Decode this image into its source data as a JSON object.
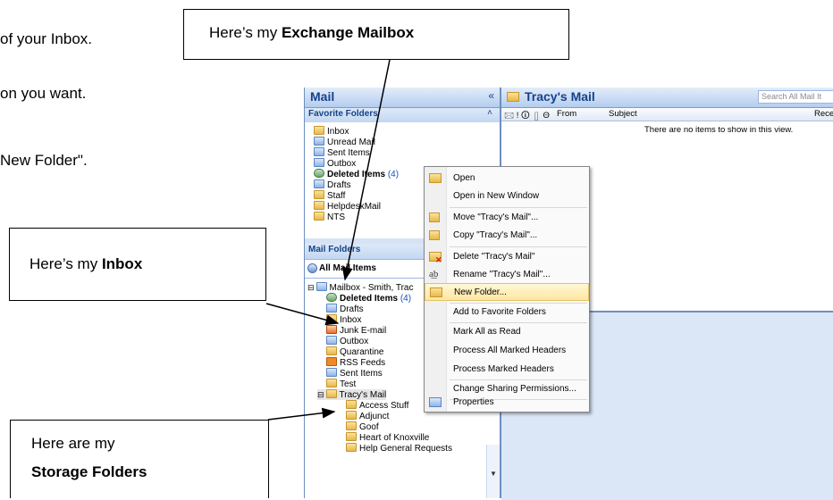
{
  "document": {
    "line1": "of your Inbox.",
    "line2": "on you want.",
    "line3": "New Folder\"."
  },
  "callouts": {
    "exchange": {
      "prefix": "Here’s my ",
      "bold": "Exchange Mailbox"
    },
    "inbox": {
      "prefix": "Here’s my ",
      "bold": "Inbox"
    },
    "storage": {
      "line1": "Here are my",
      "bold": "Storage Folders"
    }
  },
  "nav": {
    "title": "Mail",
    "collapse_glyph": "«",
    "favorites_header": "Favorite Folders",
    "favorites": [
      {
        "label": "Inbox",
        "icon": "folder-icon"
      },
      {
        "label": "Unread Mail",
        "icon": "search-folder-icon"
      },
      {
        "label": "Sent Items",
        "icon": "sent-items-icon"
      },
      {
        "label": "Outbox",
        "icon": "outbox-icon"
      },
      {
        "label": "Deleted Items",
        "count": "(4)",
        "icon": "deleted-items-icon"
      },
      {
        "label": "Drafts",
        "icon": "drafts-icon"
      },
      {
        "label": "Staff",
        "icon": "folder-icon"
      },
      {
        "label": "HelpdeskMail",
        "icon": "folder-icon"
      },
      {
        "label": "NTS",
        "icon": "folder-icon"
      }
    ],
    "mail_folders_header": "Mail Folders",
    "all_mail_items": "All Mail Items",
    "mailbox_label": "Mailbox - Smith, Trac",
    "tree": [
      {
        "label": "Deleted Items",
        "count": "(4)"
      },
      {
        "label": "Drafts"
      },
      {
        "label": "Inbox"
      },
      {
        "label": "Junk E-mail"
      },
      {
        "label": "Outbox"
      },
      {
        "label": "Quarantine"
      },
      {
        "label": "RSS Feeds"
      },
      {
        "label": "Sent Items"
      },
      {
        "label": "Test"
      },
      {
        "label": "Tracy's Mail"
      }
    ],
    "subfolders": [
      "Access Stuff",
      "Adjunct",
      "Goof",
      "Heart of Knoxville",
      "Help General Requests"
    ]
  },
  "main": {
    "title": "Tracy's Mail",
    "search_placeholder": "Search All Mail It",
    "columns": {
      "from": "From",
      "subject": "Subject",
      "received": "Rece"
    },
    "empty_message": "There are no items to show in this view."
  },
  "context_menu": {
    "items": [
      {
        "label": "Open",
        "icon": "open-folder-icon"
      },
      {
        "label": "Open in New Window"
      },
      {
        "label": "Move \"Tracy's Mail\"...",
        "icon": "move-icon"
      },
      {
        "label": "Copy \"Tracy's Mail\"...",
        "icon": "copy-icon"
      },
      {
        "label": "Delete \"Tracy's Mail\"",
        "icon": "delete-icon"
      },
      {
        "label": "Rename \"Tracy's Mail\"...",
        "icon": "rename-icon"
      },
      {
        "label": "New Folder...",
        "icon": "new-folder-icon",
        "highlighted": true
      },
      {
        "label": "Add to Favorite Folders"
      },
      {
        "label": "Mark All as Read"
      },
      {
        "label": "Process All Marked Headers"
      },
      {
        "label": "Process Marked Headers"
      },
      {
        "label": "Change Sharing Permissions..."
      },
      {
        "label": "Properties",
        "icon": "properties-icon"
      }
    ]
  }
}
